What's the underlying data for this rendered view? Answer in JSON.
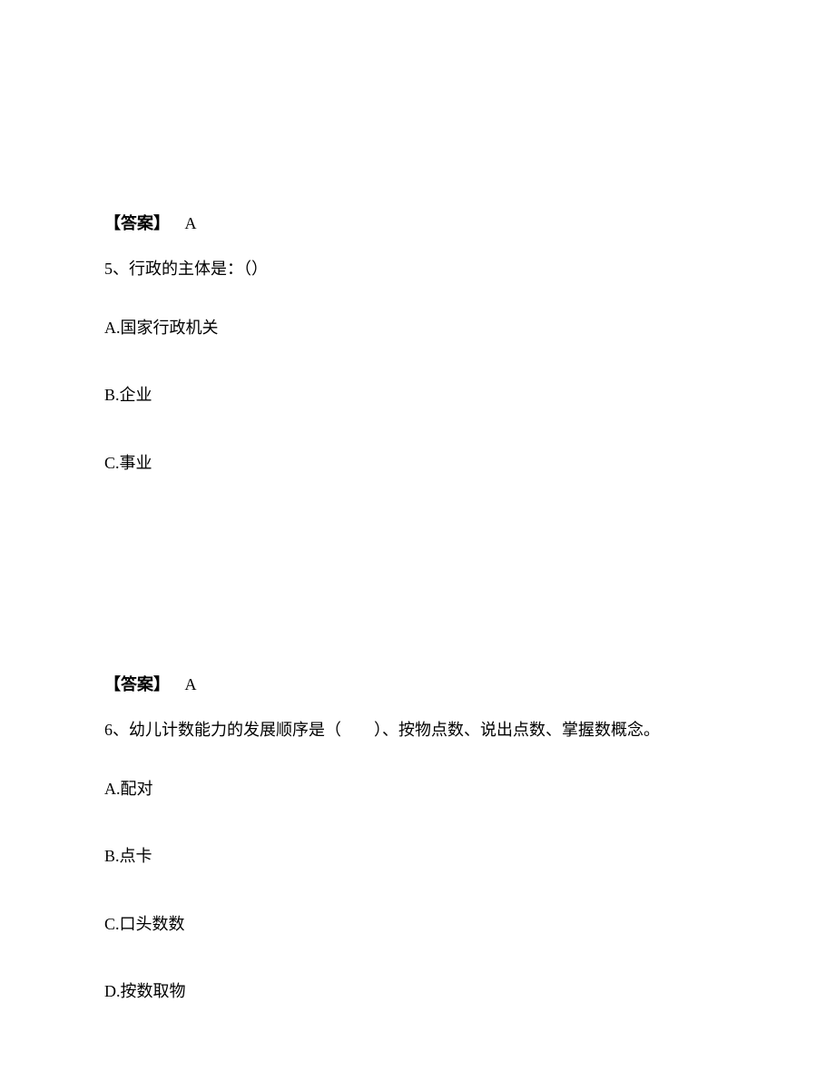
{
  "q5": {
    "prev_answer_label": "【答案】",
    "prev_answer_value": "A",
    "question_text": "5、行政的主体是：（）",
    "options": {
      "a": "A.国家行政机关",
      "b": "B.企业",
      "c": "C.事业"
    }
  },
  "q6": {
    "prev_answer_label": "【答案】",
    "prev_answer_value": "A",
    "question_text": "6、幼儿计数能力的发展顺序是（　　）、按物点数、说出点数、掌握数概念。",
    "options": {
      "a": "A.配对",
      "b": "B.点卡",
      "c": "C.口头数数",
      "d": "D.按数取物"
    }
  }
}
